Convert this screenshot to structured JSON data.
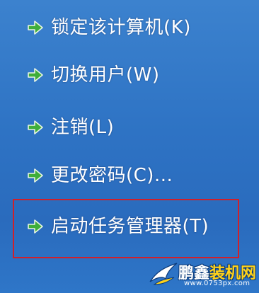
{
  "menu": {
    "items": [
      {
        "label": "锁定该计算机(K)",
        "icon": "green-arrow-icon"
      },
      {
        "label": "切换用户(W)",
        "icon": "green-arrow-icon"
      },
      {
        "label": "注销(L)",
        "icon": "green-arrow-icon"
      },
      {
        "label": "更改密码(C)...",
        "icon": "green-arrow-icon"
      },
      {
        "label": "启动任务管理器(T)",
        "icon": "green-arrow-icon"
      }
    ],
    "highlighted_item": "启动任务管理器(T)"
  },
  "watermark": {
    "brand_part1": "鹏鑫",
    "brand_part2": "装机网",
    "url": "www.0753px.com"
  },
  "colors": {
    "background": "#2e73c4",
    "text": "#ffffff",
    "arrow": "#3fae3a",
    "highlight_border": "#d0202a",
    "watermark_accent": "#ffd21a"
  }
}
